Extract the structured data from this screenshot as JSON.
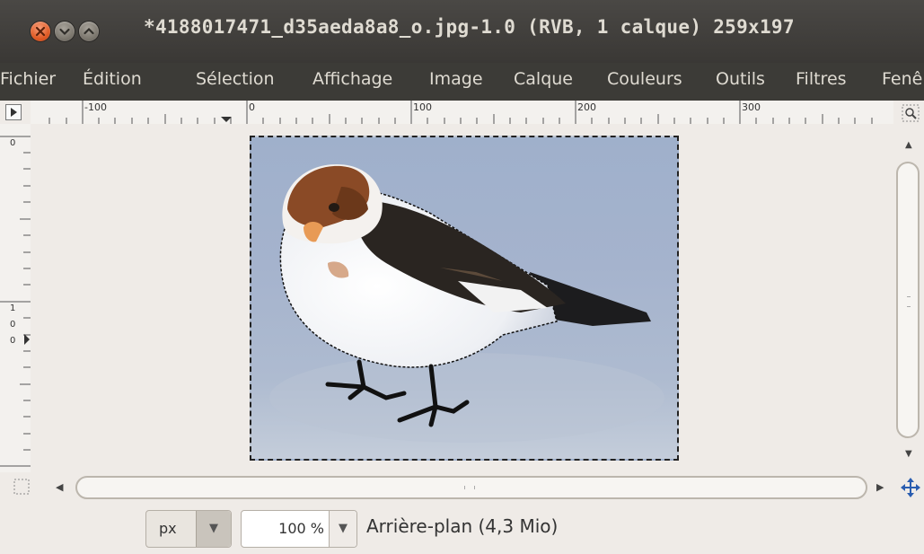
{
  "window": {
    "title": "*4188017471_d35aeda8a8_o.jpg-1.0 (RVB, 1 calque) 259x197",
    "buttons": [
      "close-icon",
      "minimize-icon",
      "maximize-icon"
    ]
  },
  "menu": {
    "items": [
      "Fichier",
      "Édition",
      "Sélection",
      "Affichage",
      "Image",
      "Calque",
      "Couleurs",
      "Outils",
      "Filtres",
      "Fenê"
    ]
  },
  "rulers": {
    "horizontal_labels": [
      "-100",
      "0",
      "100",
      "200",
      "300"
    ],
    "vertical_labels": [
      "0",
      "1",
      "0",
      "0"
    ]
  },
  "status": {
    "unit": "px",
    "zoom": "100 %",
    "layer_info": "Arrière-plan (4,3 Mio)"
  },
  "colors": {
    "titlebar": "#3c3b37",
    "close_button": "#e05a24",
    "background": "#efebe7",
    "snow": "#a5b3cd"
  }
}
